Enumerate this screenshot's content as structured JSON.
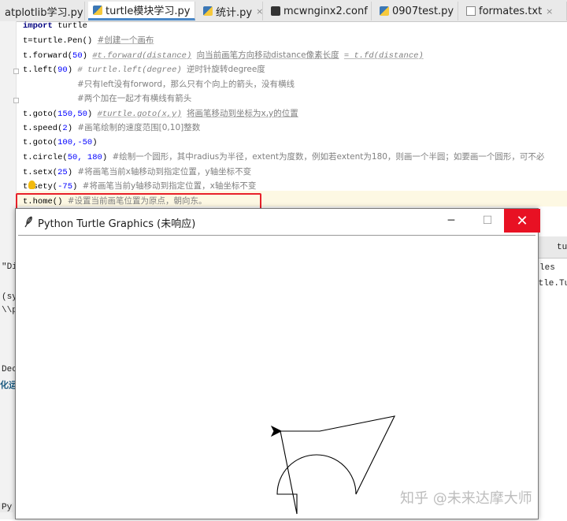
{
  "tabs": [
    {
      "label": "atplotlib学习.py",
      "icon": "python-file-icon"
    },
    {
      "label": "turtle模块学习.py",
      "icon": "python-file-icon"
    },
    {
      "label": "统计.py",
      "icon": "python-file-icon"
    },
    {
      "label": "mcwnginx2.conf",
      "icon": "config-file-icon"
    },
    {
      "label": "0907test.py",
      "icon": "python-file-icon"
    },
    {
      "label": "formates.txt",
      "icon": "text-file-icon"
    }
  ],
  "close_glyph": "×",
  "code": {
    "l1_kw": "import",
    "l1_rest": " turtle",
    "l2_code": "t=turtle.Pen()",
    "l2_cm": "#创建一个画布",
    "l3_fn": "t.forward(",
    "l3_num": "50",
    "l3_close": ")",
    "l3_cm1": "#t.forward(distance)",
    "l3_cm2": "向当前画笔方向移动distance像素长度",
    "l3_cm3": "= t.fd(distance)",
    "l4_fn": "t.left(",
    "l4_num": "90",
    "l4_close": ")",
    "l4_cm1": "# turtle.left(degree)",
    "l4_cm2": "逆时针旋转degree度",
    "l5_cm": "#只有left没有forword，那么只有个向上的箭头，没有横线",
    "l6_cm": "#两个加在一起才有横线有箭头",
    "l7_fn": "t.goto(",
    "l7_num": "150,50",
    "l7_close": ")",
    "l7_cm1": "#turtle.goto(x,y)",
    "l7_cm2": "将画笔移动到坐标为x,y的位置",
    "l8_fn": "t.speed(",
    "l8_num": "2",
    "l8_close": ")",
    "l8_cm": "#画笔绘制的速度范围[0,10]整数",
    "l9_fn": "t.goto(",
    "l9_num": "100,-50",
    "l9_close": ")",
    "l10_fn": "t.circle(",
    "l10_num": "50, 180",
    "l10_close": ")",
    "l10_cm": "#绘制一个圆形，其中radius为半径，extent为度数，例如若extent为180，则画一个半圆；如要画一个圆形，可不必",
    "l11_fn": "t.setx(",
    "l11_num": "25",
    "l11_close": ")",
    "l11_cm": "#将画笔当前x轴移动到指定位置，y轴坐标不变",
    "l12_fn": "t.sety(",
    "l12_num": "-75",
    "l12_close": ")",
    "l12_cm": "#将画笔当前y轴移动到指定位置，x轴坐标不变",
    "l13_fn": "t.home()",
    "l13_cm": "#设置当前画笔位置为原点，朝向东。"
  },
  "background": {
    "left_fragments": [
      "\"Di",
      "(sy",
      "\\\\p",
      "Dec",
      "化运",
      "Py"
    ],
    "right_tab": "tu",
    "right_fragments": [
      "les",
      "rtle.Tu"
    ]
  },
  "turtle_window": {
    "title": "Python Turtle Graphics (未响应)",
    "minimize": "─",
    "maximize": "☐",
    "close": "✕"
  },
  "watermark": "知乎 @未来达摩大师",
  "colors": {
    "accent": "#4a88c7",
    "close_red": "#e81123",
    "highlight_red": "#e8202a"
  }
}
